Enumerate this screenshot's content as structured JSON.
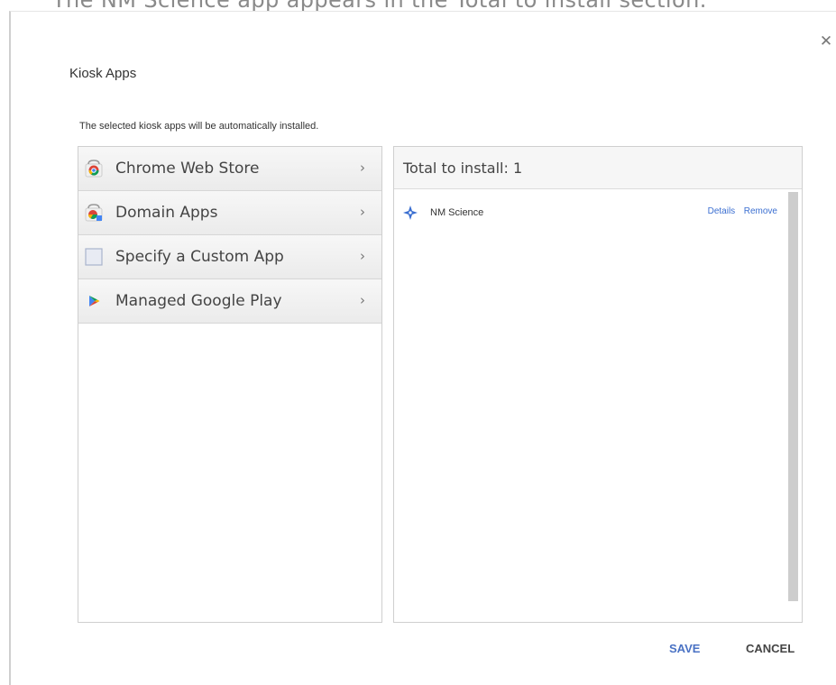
{
  "caption": "The NM Science app appears in the Total to install section.",
  "dialog": {
    "title": "Kiosk Apps",
    "subtitle": "The selected kiosk apps will be automatically installed.",
    "close_icon": "close-icon",
    "categories": [
      {
        "label": "Chrome Web Store",
        "icon": "chrome-web-store-icon"
      },
      {
        "label": "Domain Apps",
        "icon": "domain-apps-icon"
      },
      {
        "label": "Specify a Custom App",
        "icon": "custom-app-icon"
      },
      {
        "label": "Managed Google Play",
        "icon": "google-play-icon"
      }
    ],
    "total_header": "Total to install: 1",
    "apps": [
      {
        "name": "NM Science",
        "icon": "puzzle-icon",
        "details_label": "Details",
        "remove_label": "Remove"
      }
    ],
    "save_label": "SAVE",
    "cancel_label": "CANCEL"
  },
  "colors": {
    "accent": "#4a72c4",
    "link": "#3b6fd1",
    "panel_border": "#cfcfcf"
  }
}
